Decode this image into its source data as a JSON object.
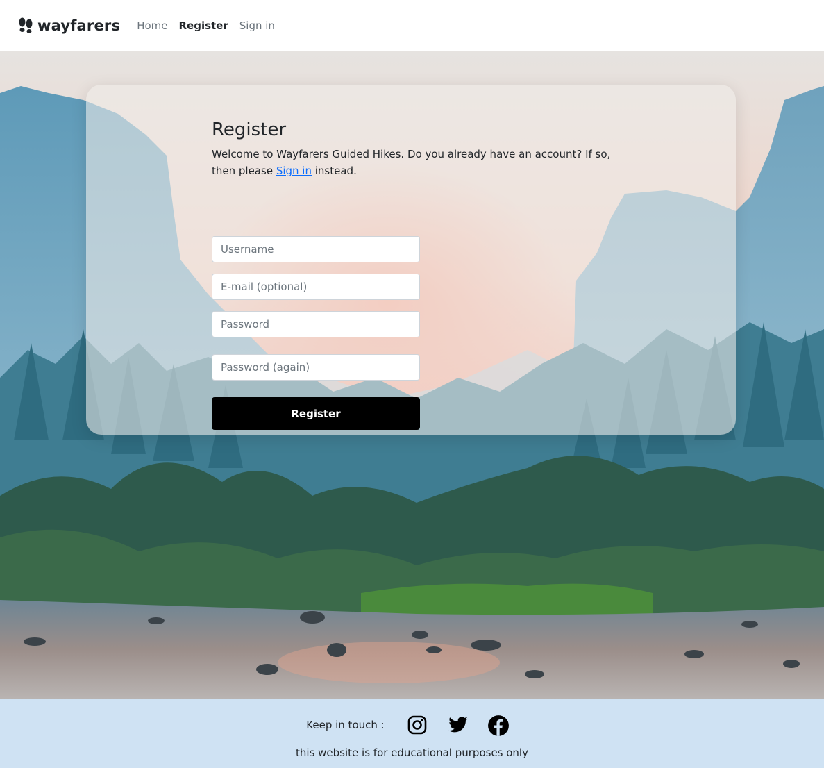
{
  "nav": {
    "brand": "wayfarers",
    "links": [
      "Home",
      "Register",
      "Sign in"
    ],
    "active": "Register"
  },
  "form": {
    "title": "Register",
    "intro_before": "Welcome to Wayfarers Guided Hikes. Do you already have an account? If so, then please ",
    "intro_link": "Sign in",
    "intro_after": " instead.",
    "username_placeholder": "Username",
    "email_placeholder": "E-mail (optional)",
    "password_placeholder": "Password",
    "password_again_placeholder": "Password (again)",
    "submit_label": "Register"
  },
  "footer": {
    "keep_in_touch": "Keep in touch :",
    "social": [
      "instagram-icon",
      "twitter-icon",
      "facebook-icon"
    ],
    "note": "this website is for educational purposes only"
  },
  "colors": {
    "footer_bg": "#cfe2f3",
    "button_bg": "#000000",
    "link": "#0d6efd"
  }
}
